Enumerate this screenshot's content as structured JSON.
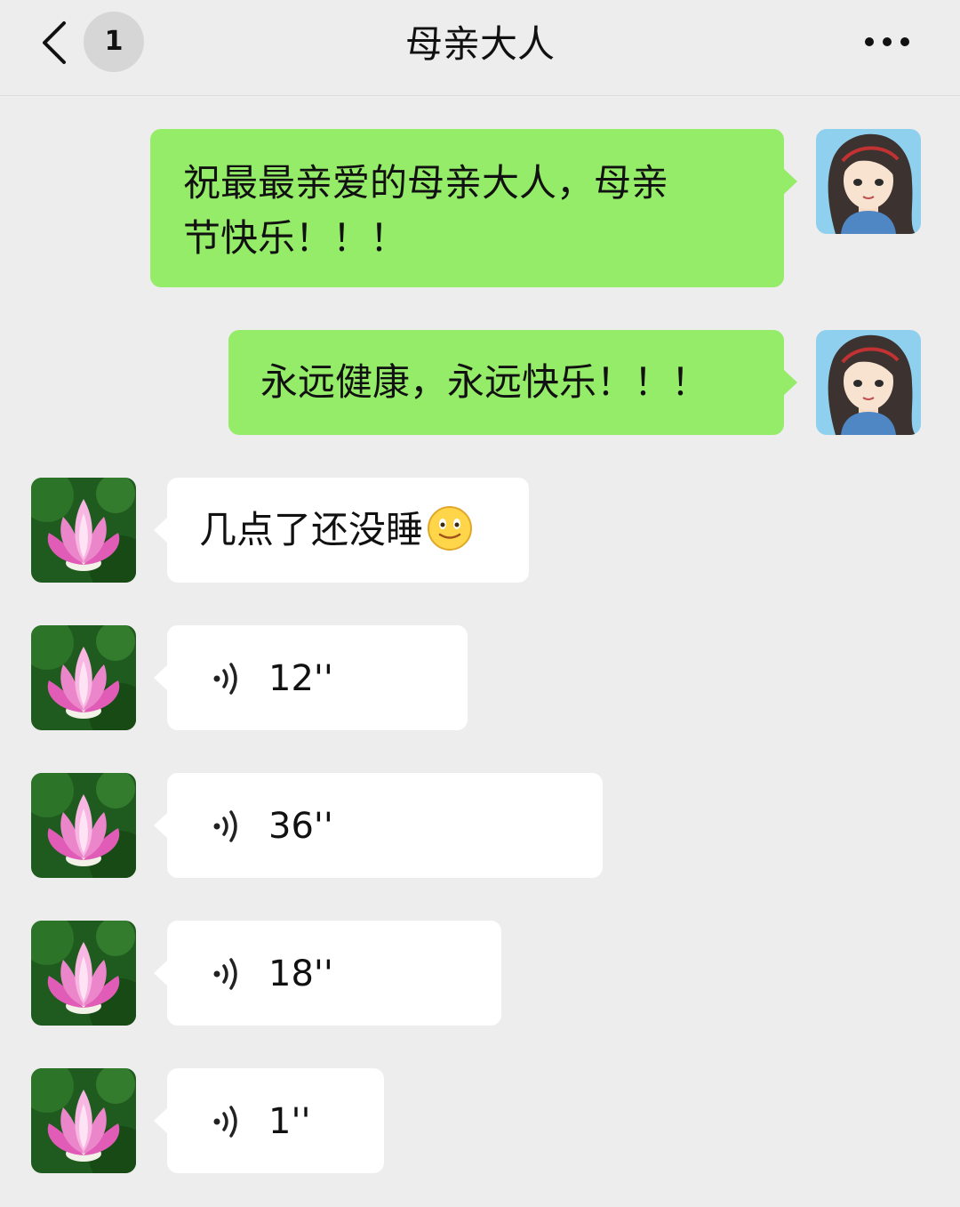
{
  "header": {
    "back_icon": "chevron-left-icon",
    "unread_count": "1",
    "title": "母亲大人",
    "more_icon": "more-dots-icon"
  },
  "messages": [
    {
      "direction": "out",
      "type": "text",
      "text_line1": "祝最最亲爱的母亲大人，母亲",
      "text_line2": "节快乐！！！",
      "avatar": "girl-cartoon-avatar"
    },
    {
      "direction": "out",
      "type": "text",
      "text": "永远健康，永远快乐！！！",
      "avatar": "girl-cartoon-avatar"
    },
    {
      "direction": "in",
      "type": "text",
      "text": "几点了还没睡",
      "emoji": "smile-emoji",
      "avatar": "lotus-avatar"
    },
    {
      "direction": "in",
      "type": "voice",
      "duration": "12''",
      "avatar": "lotus-avatar"
    },
    {
      "direction": "in",
      "type": "voice",
      "duration": "36''",
      "avatar": "lotus-avatar"
    },
    {
      "direction": "in",
      "type": "voice",
      "duration": "18''",
      "avatar": "lotus-avatar"
    },
    {
      "direction": "in",
      "type": "voice",
      "duration": "1''",
      "avatar": "lotus-avatar"
    }
  ],
  "colors": {
    "background": "#ededed",
    "outgoing_bubble": "#95ec69",
    "incoming_bubble": "#ffffff"
  }
}
